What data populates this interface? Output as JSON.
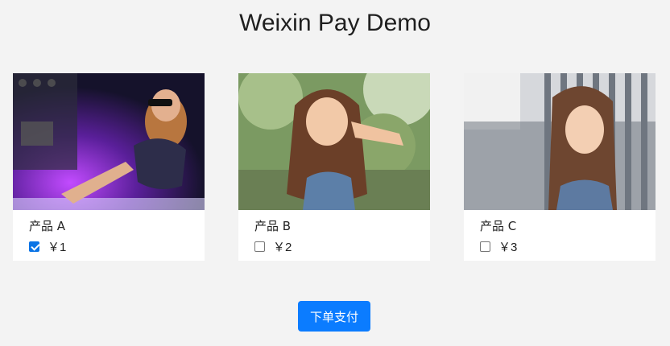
{
  "page": {
    "title": "Weixin Pay Demo"
  },
  "products": [
    {
      "name": "产品 A",
      "price": "￥1",
      "checked": true
    },
    {
      "name": "产品 B",
      "price": "￥2",
      "checked": false
    },
    {
      "name": "产品 C",
      "price": "￥3",
      "checked": false
    }
  ],
  "actions": {
    "pay_label": "下单支付"
  },
  "colors": {
    "accent": "#0b7cff",
    "background": "#f3f3f3",
    "card": "#ffffff"
  }
}
